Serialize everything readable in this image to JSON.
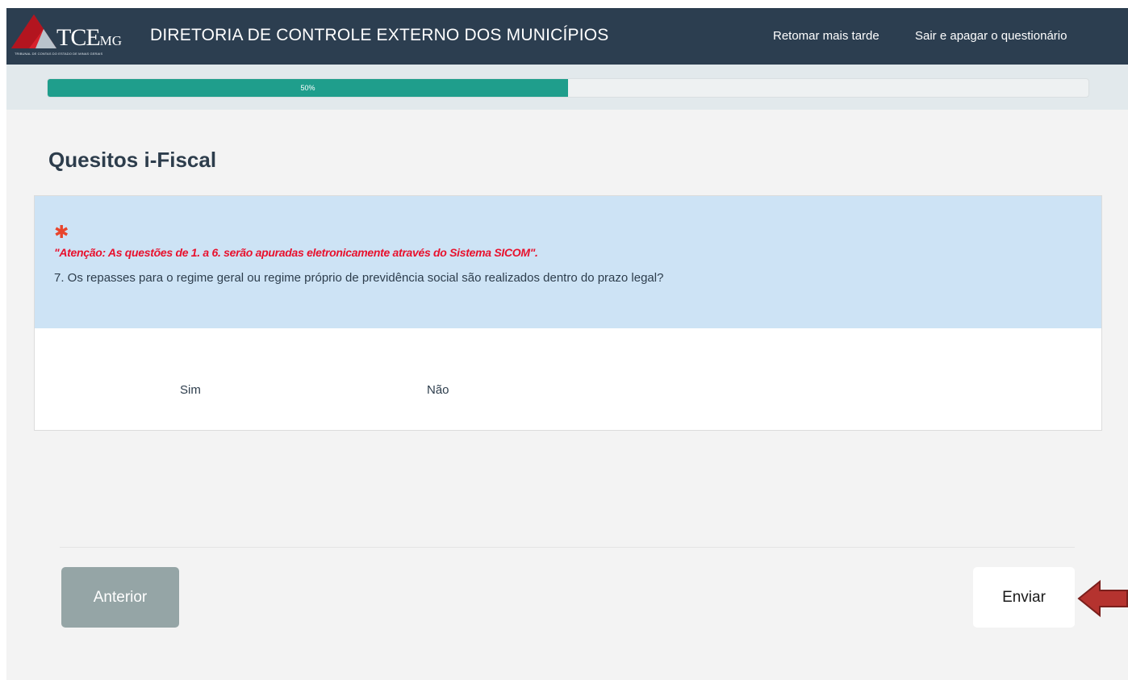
{
  "header": {
    "logo_text_main": "TCE",
    "logo_text_sub": "MG",
    "logo_tagline": "TRIBUNAL DE CONTAS DO ESTADO DE MINAS GERAIS",
    "org_title": "DIRETORIA DE CONTROLE EXTERNO DOS MUNICÍPIOS",
    "nav": {
      "resume_later": "Retomar mais tarde",
      "exit_delete": "Sair e apagar o questionário"
    }
  },
  "progress": {
    "percent": 50,
    "label": "50%"
  },
  "page": {
    "title": "Quesitos i-Fiscal"
  },
  "question": {
    "required_mark": "✱",
    "attention": "\"Atenção: As questões de 1. a 6. serão apuradas eletronicamente através do Sistema SICOM\".",
    "text": "7. Os repasses para o regime geral ou regime próprio de previdência social são realizados dentro do prazo legal?",
    "options": [
      "Sim",
      "Não"
    ]
  },
  "buttons": {
    "previous": "Anterior",
    "send": "Enviar"
  },
  "colors": {
    "header_bg": "#2c3e50",
    "progress_fill": "#1f9e8c",
    "question_bg": "#cde3f5",
    "attention_red": "#e8112d",
    "arrow_red": "#b5332f"
  },
  "icons": {
    "logo": "tce-triangle-logo",
    "pointer": "left-arrow-annotation"
  }
}
